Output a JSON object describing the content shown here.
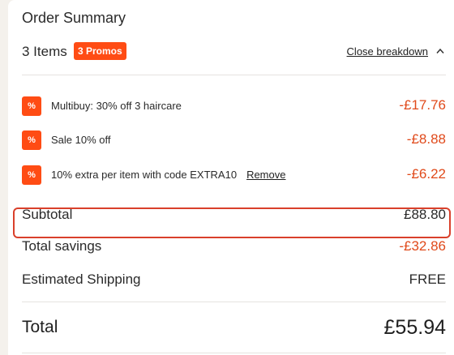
{
  "summary": {
    "title": "Order Summary",
    "items_count": "3 Items",
    "promo_badge": "3 Promos",
    "close_breakdown": "Close breakdown"
  },
  "promos": [
    {
      "icon": "percent-icon",
      "label": "Multibuy: 30% off 3 haircare",
      "amount": "-£17.76"
    },
    {
      "icon": "percent-icon",
      "label": "Sale 10% off",
      "amount": "-£8.88"
    },
    {
      "icon": "percent-icon",
      "label": "10% extra per item with code EXTRA10",
      "remove_label": "Remove",
      "amount": "-£6.22"
    }
  ],
  "totals": {
    "subtotal_label": "Subtotal",
    "subtotal_value": "£88.80",
    "savings_label": "Total savings",
    "savings_value": "-£32.86",
    "shipping_label": "Estimated Shipping",
    "shipping_value": "FREE",
    "total_label": "Total",
    "total_value": "£55.94"
  },
  "icon_glyph": "%",
  "colors": {
    "accent": "#ff4c14",
    "savings_text": "#e04a1b",
    "highlight_border": "#d9402b"
  }
}
